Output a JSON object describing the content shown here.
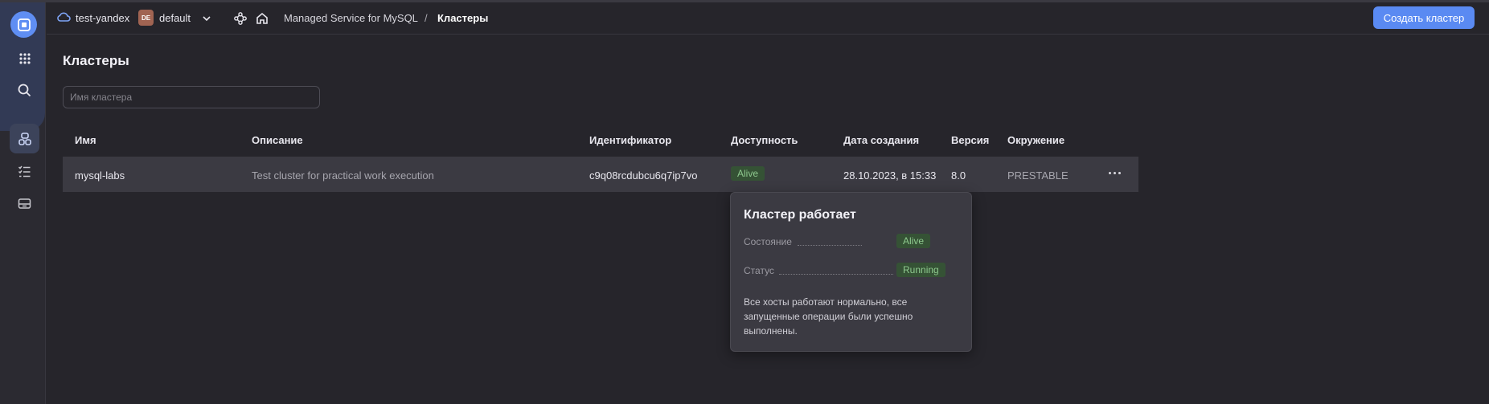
{
  "header": {
    "cloud_name": "test-yandex",
    "folder_badge": "DE",
    "folder_name": "default",
    "breadcrumb_service": "Managed Service for MySQL",
    "breadcrumb_separator": "/",
    "breadcrumb_current": "Кластеры",
    "create_button": "Создать кластер"
  },
  "page": {
    "title": "Кластеры",
    "search_placeholder": "Имя кластера"
  },
  "table": {
    "columns": [
      "Имя",
      "Описание",
      "Идентификатор",
      "Доступность",
      "Дата создания",
      "Версия",
      "Окружение"
    ],
    "rows": [
      {
        "name": "mysql-labs",
        "description": "Test cluster for practical work execution",
        "id": "c9q08rcdubcu6q7ip7vo",
        "availability": "Alive",
        "created": "28.10.2023, в 15:33",
        "version": "8.0",
        "environment": "PRESTABLE"
      }
    ]
  },
  "tooltip": {
    "title": "Кластер работает",
    "state_label": "Состояние",
    "state_value": "Alive",
    "status_label": "Статус",
    "status_value": "Running",
    "description": "Все хосты работают нормально, все запущенные операции были успешно выполнены."
  },
  "colors": {
    "accent": "#5a8af2",
    "background": "#26252b",
    "badge_bg": "#355235",
    "badge_text": "#8ec98e"
  },
  "icons": {
    "rail": [
      "logo-icon",
      "apps-grid-icon",
      "search-icon",
      "clusters-icon",
      "operations-list-icon",
      "backups-icon"
    ],
    "header": [
      "cloud-icon",
      "chevron-down-icon",
      "graph-icon",
      "home-icon"
    ]
  }
}
